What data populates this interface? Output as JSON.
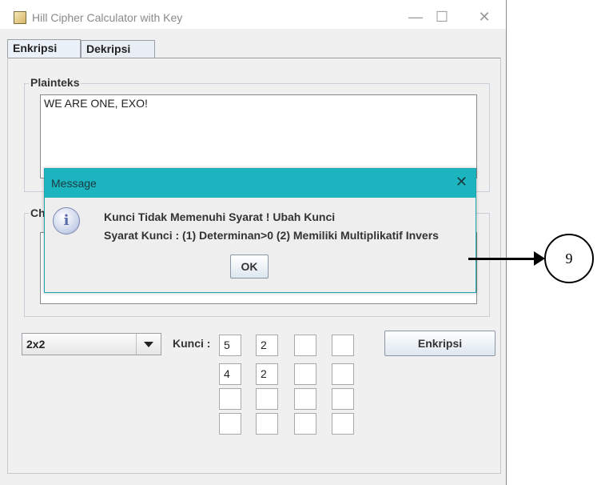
{
  "window": {
    "title": "Hill Cipher Calculator with Key",
    "controls": {
      "minimize": "—",
      "maximize": "☐",
      "close": "✕"
    }
  },
  "tabs": [
    {
      "label": "Enkripsi",
      "active": true
    },
    {
      "label": "Dekripsi",
      "active": false
    }
  ],
  "plaintext": {
    "group_label": "Plainteks",
    "value": "WE ARE ONE, EXO!"
  },
  "ciphertext": {
    "group_label_partial": "Ch",
    "value": ""
  },
  "controls": {
    "size_select": "2x2",
    "key_label": "Kunci :",
    "encrypt_button": "Enkripsi"
  },
  "key_matrix": [
    [
      "5",
      "2",
      "",
      ""
    ],
    [
      "4",
      "2",
      "",
      ""
    ],
    [
      "",
      "",
      "",
      ""
    ],
    [
      "",
      "",
      "",
      ""
    ]
  ],
  "dialog": {
    "title": "Message",
    "close": "✕",
    "icon": "info-icon",
    "icon_glyph": "i",
    "line1": "Kunci Tidak Memenuhi Syarat ! Ubah Kunci",
    "line2": "Syarat Kunci : (1) Determinan>0 (2) Memiliki Multiplikatif Invers",
    "ok": "OK",
    "accent": "#1bb4bf"
  },
  "annotation": {
    "number": "9"
  }
}
